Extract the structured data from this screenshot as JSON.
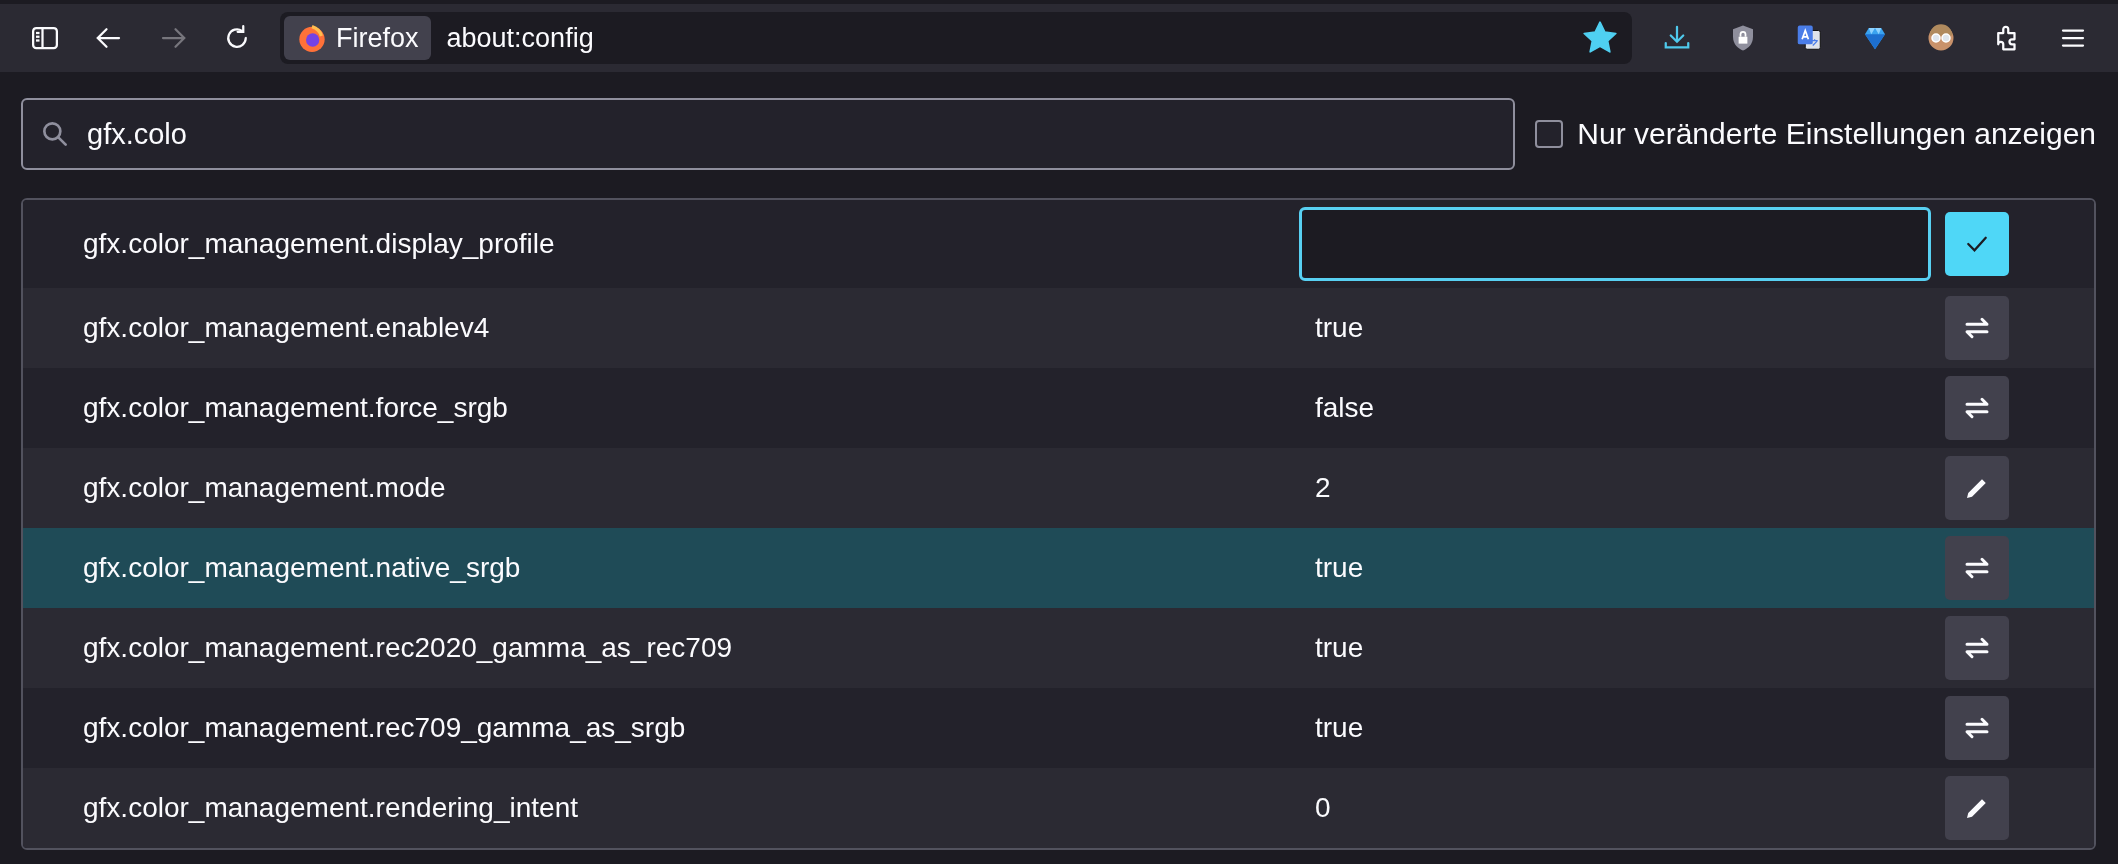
{
  "toolbar": {
    "nav_buttons": [
      {
        "kind": "sidebar",
        "disabled": false
      },
      {
        "kind": "back",
        "disabled": false
      },
      {
        "kind": "forward",
        "disabled": true
      },
      {
        "kind": "reload",
        "disabled": false
      }
    ],
    "identity_label": "Firefox",
    "url": "about:config",
    "bookmarked": true,
    "extension_buttons": [
      {
        "kind": "download"
      },
      {
        "kind": "shield"
      },
      {
        "kind": "translate"
      },
      {
        "kind": "gem"
      },
      {
        "kind": "avatar"
      },
      {
        "kind": "puzzle"
      },
      {
        "kind": "menu"
      }
    ]
  },
  "search": {
    "value": "gfx.colo"
  },
  "modified_only": {
    "label": "Nur veränderte Einstellungen anzeigen",
    "checked": false
  },
  "prefs": [
    {
      "name": "gfx.color_management.display_profile",
      "kind": "editing",
      "highlighted": false
    },
    {
      "name": "gfx.color_management.enablev4",
      "kind": "boolean",
      "value": "true",
      "highlighted": false
    },
    {
      "name": "gfx.color_management.force_srgb",
      "kind": "boolean",
      "value": "false",
      "highlighted": false
    },
    {
      "name": "gfx.color_management.mode",
      "kind": "number",
      "value": "2",
      "highlighted": false
    },
    {
      "name": "gfx.color_management.native_srgb",
      "kind": "boolean",
      "value": "true",
      "highlighted": true
    },
    {
      "name": "gfx.color_management.rec2020_gamma_as_rec709",
      "kind": "boolean",
      "value": "true",
      "highlighted": false
    },
    {
      "name": "gfx.color_management.rec709_gamma_as_srgb",
      "kind": "boolean",
      "value": "true",
      "highlighted": false
    },
    {
      "name": "gfx.color_management.rendering_intent",
      "kind": "number",
      "value": "0",
      "highlighted": false
    }
  ]
}
